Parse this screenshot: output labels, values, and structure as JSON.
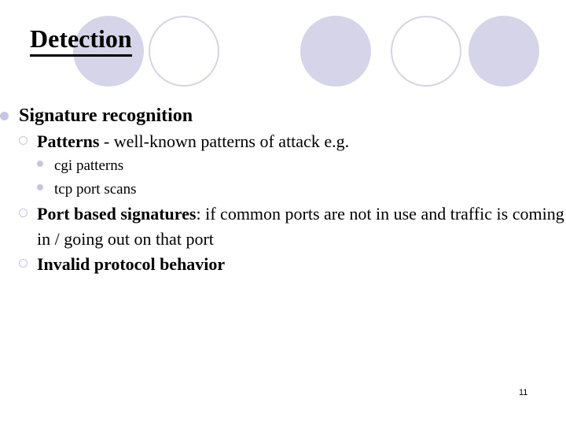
{
  "slide": {
    "title": "Detection",
    "page_number": "11",
    "accent_color": "#d5d4e8",
    "bullet_color": "#c6c5e4",
    "text_color": "#000000",
    "background_color": "#ffffff"
  },
  "decorations": {
    "circles": [
      {
        "name": "circle-1",
        "style": "filled"
      },
      {
        "name": "circle-2",
        "style": "outline"
      },
      {
        "name": "circle-3",
        "style": "filled"
      },
      {
        "name": "circle-4",
        "style": "outline"
      },
      {
        "name": "circle-5",
        "style": "filled"
      }
    ]
  },
  "content": {
    "level1": {
      "text": "Signature recognition"
    },
    "patterns": {
      "lead": "Patterns",
      "rest": " - well-known patterns of attack e.g.",
      "examples": [
        {
          "text": "cgi patterns"
        },
        {
          "text": "tcp port scans"
        }
      ]
    },
    "port_based": {
      "lead": "Port based signatures",
      "rest": ": if common ports are not in use and traffic is coming in / going out on that port"
    },
    "invalid_protocol": {
      "lead": "Invalid protocol behavior",
      "rest": ""
    }
  }
}
